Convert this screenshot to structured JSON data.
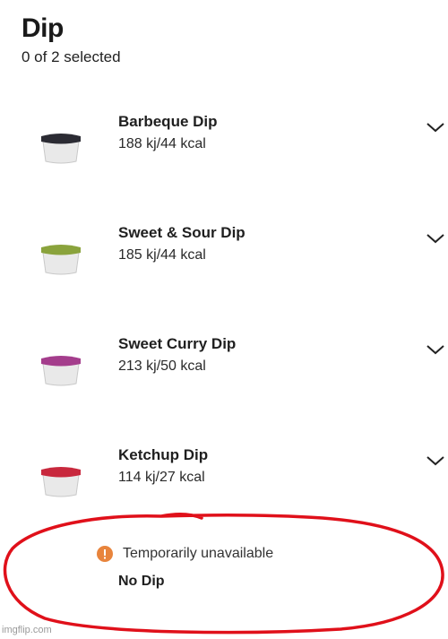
{
  "header": {
    "title": "Dip",
    "subtitle": "0 of 2 selected"
  },
  "items": [
    {
      "name": "Barbeque Dip",
      "kcal": "188 kj/44 kcal",
      "lid_color": "#2b2b33"
    },
    {
      "name": "Sweet & Sour Dip",
      "kcal": "185 kj/44 kcal",
      "lid_color": "#8aa33c"
    },
    {
      "name": "Sweet Curry Dip",
      "kcal": "213 kj/50 kcal",
      "lid_color": "#a43d8c"
    },
    {
      "name": "Ketchup Dip",
      "kcal": "114 kj/27 kcal",
      "lid_color": "#c8283d"
    }
  ],
  "unavailable": {
    "status": "Temporarily unavailable",
    "item": "No Dip",
    "warning_color": "#e8843c"
  },
  "annotation_color": "#e0101a",
  "watermark": "imgflip.com"
}
